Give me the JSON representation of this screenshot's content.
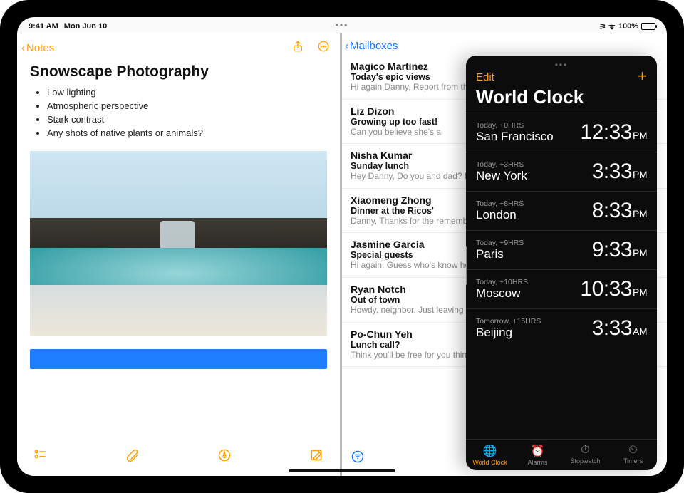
{
  "status": {
    "time": "9:41 AM",
    "date": "Mon Jun 10",
    "battery": "100%"
  },
  "notes": {
    "back": "Notes",
    "title": "Snowscape Photography",
    "bullets": [
      "Low lighting",
      "Atmospheric perspective",
      "Stark contrast",
      "Any shots of native plants or animals?"
    ]
  },
  "mail": {
    "back": "Mailboxes",
    "items": [
      {
        "from": "Magico Martinez",
        "subject": "Today's epic views",
        "preview": "Hi again Danny, Report from the field: Wide open skies, a ger"
      },
      {
        "from": "Liz Dizon",
        "subject": "Growing up too fast!",
        "preview": "Can you believe she's a"
      },
      {
        "from": "Nisha Kumar",
        "subject": "Sunday lunch",
        "preview": "Hey Danny, Do you and dad? If you two join, th"
      },
      {
        "from": "Xiaomeng Zhong",
        "subject": "Dinner at the Ricos'",
        "preview": "Danny, Thanks for the remembered to take or"
      },
      {
        "from": "Jasmine Garcia",
        "subject": "Special guests",
        "preview": "Hi again. Guess who's know how to make me"
      },
      {
        "from": "Ryan Notch",
        "subject": "Out of town",
        "preview": "Howdy, neighbor. Just leaving Tuesday and wi"
      },
      {
        "from": "Po-Chun Yeh",
        "subject": "Lunch call?",
        "preview": "Think you'll be free for you think might work a"
      }
    ]
  },
  "clock": {
    "edit": "Edit",
    "title": "World Clock",
    "cities": [
      {
        "meta": "Today, +0HRS",
        "name": "San Francisco",
        "time": "12:33",
        "ampm": "PM"
      },
      {
        "meta": "Today, +3HRS",
        "name": "New York",
        "time": "3:33",
        "ampm": "PM"
      },
      {
        "meta": "Today, +8HRS",
        "name": "London",
        "time": "8:33",
        "ampm": "PM"
      },
      {
        "meta": "Today, +9HRS",
        "name": "Paris",
        "time": "9:33",
        "ampm": "PM"
      },
      {
        "meta": "Today, +10HRS",
        "name": "Moscow",
        "time": "10:33",
        "ampm": "PM"
      },
      {
        "meta": "Tomorrow, +15HRS",
        "name": "Beijing",
        "time": "3:33",
        "ampm": "AM"
      }
    ],
    "tabs": [
      {
        "icon": "🌐",
        "label": "World Clock"
      },
      {
        "icon": "⏰",
        "label": "Alarms"
      },
      {
        "icon": "⏱",
        "label": "Stopwatch"
      },
      {
        "icon": "⏲",
        "label": "Timers"
      }
    ]
  }
}
